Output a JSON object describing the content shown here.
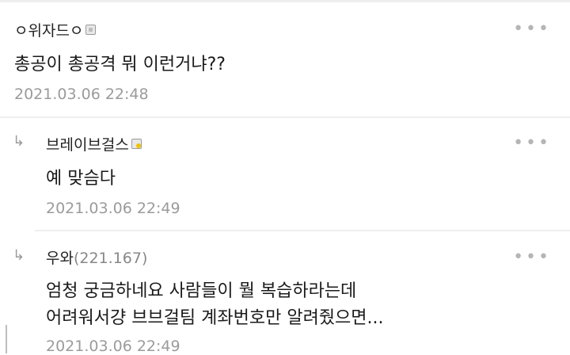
{
  "comments": [
    {
      "author": "ㅇ위자드ㅇ",
      "ip": "",
      "body": "총공이 총공격 뭐 이런거냐??",
      "time": "2021.03.06 22:48",
      "more": "•••"
    },
    {
      "author": "브레이브걸스",
      "ip": "",
      "body": "예 맞슴다",
      "time": "2021.03.06 22:49",
      "more": "•••",
      "reply_marker": "↳"
    },
    {
      "author": "우와",
      "ip": "(221.167)",
      "body_line1": "엄청 궁금하네요 사람들이 뭘 복습하라는데",
      "body_line2": "어려워서걍 브브걸팀 계좌번호만 알려줬으면...",
      "time": "2021.03.06 22:49",
      "more": "•••",
      "reply_marker": "↳"
    }
  ]
}
